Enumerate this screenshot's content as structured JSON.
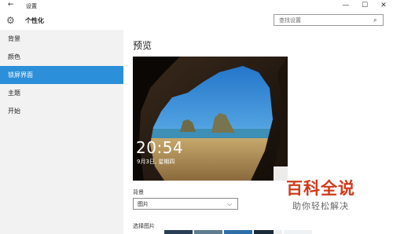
{
  "window": {
    "title": "设置",
    "controls": {
      "minimize": "—",
      "maximize": "☐",
      "close": "✕"
    }
  },
  "header": {
    "back_glyph": "←",
    "gear_glyph": "⚙",
    "section_title": "个性化",
    "search_placeholder": "查找设置",
    "search_glyph": "⌕"
  },
  "sidebar": {
    "items": [
      {
        "label": "背景",
        "active": false
      },
      {
        "label": "颜色",
        "active": false
      },
      {
        "label": "锁屏界面",
        "active": true
      },
      {
        "label": "主题",
        "active": false
      },
      {
        "label": "开始",
        "active": false
      }
    ]
  },
  "main": {
    "preview_title": "预览",
    "lock_time": "20:54",
    "lock_date": "9月3日, 星期四",
    "background_label": "背景",
    "background_value": "图片",
    "dropdown_glyph": "⌵",
    "choose_picture_label": "选择图片"
  },
  "watermark": {
    "main": "百科全说",
    "sub": "助你轻松解决"
  },
  "colors": {
    "accent": "#2b8fd9",
    "sidebar_bg": "#f2f2f2",
    "watermark_red": "#d03a1a"
  }
}
